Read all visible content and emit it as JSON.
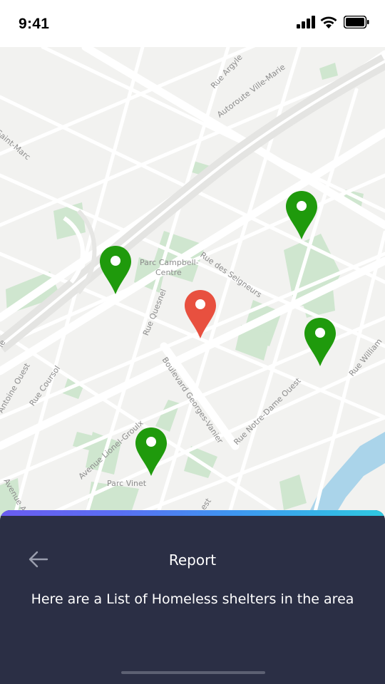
{
  "status_bar": {
    "time": "9:41"
  },
  "map": {
    "street_labels": [
      "Rue Argyle",
      "Autoroute Ville-Marie",
      "Saint-Marc",
      "Parc Campbell-",
      "Centre",
      "Rue des Seigneurs",
      "Rue Quesnel",
      "Boulevard Georges-Vanier",
      "Rue Coursol",
      "Antoine Ouest",
      "Rue Notre-Dame Ouest",
      "Rue William",
      "Avenue Lionel-Groulx",
      "Parc Vinet",
      "Avenue Atw",
      "ie",
      "est"
    ],
    "markers": [
      {
        "kind": "shelter",
        "color": "#1f9a0c"
      },
      {
        "kind": "shelter",
        "color": "#1f9a0c"
      },
      {
        "kind": "current-location",
        "color": "#e8503f"
      },
      {
        "kind": "shelter",
        "color": "#1f9a0c"
      },
      {
        "kind": "shelter",
        "color": "#1f9a0c"
      }
    ]
  },
  "sheet": {
    "title": "Report",
    "message": "Here are a List of Homeless shelters in the area"
  }
}
